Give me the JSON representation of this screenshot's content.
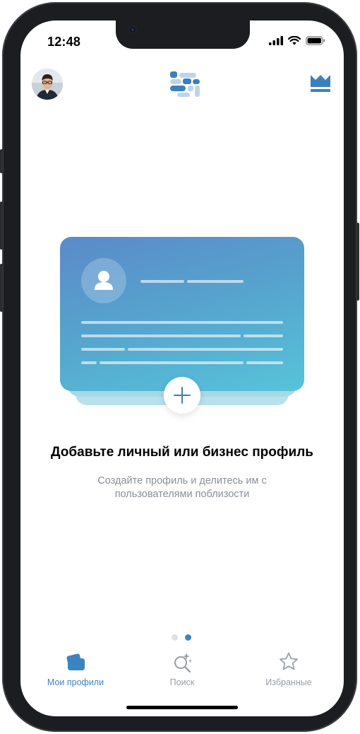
{
  "status_bar": {
    "time": "12:48"
  },
  "empty_state": {
    "headline": "Добавьте личный или бизнес профиль",
    "subtext": "Создайте профиль и делитесь им с пользователями поблизости"
  },
  "pager": {
    "count": 2,
    "active": 2
  },
  "tab_bar": {
    "tabs": [
      {
        "label": "Мои профили",
        "icon": "cards-icon",
        "active": true
      },
      {
        "label": "Поиск",
        "icon": "sparkle-search-icon",
        "active": false
      },
      {
        "label": "Избранные",
        "icon": "star-icon",
        "active": false
      }
    ]
  },
  "colors": {
    "accent": "#3c84c0",
    "inactive": "#9aa0a8",
    "card_gradient_start": "#5b8ac9",
    "card_gradient_end": "#57c3d9"
  }
}
